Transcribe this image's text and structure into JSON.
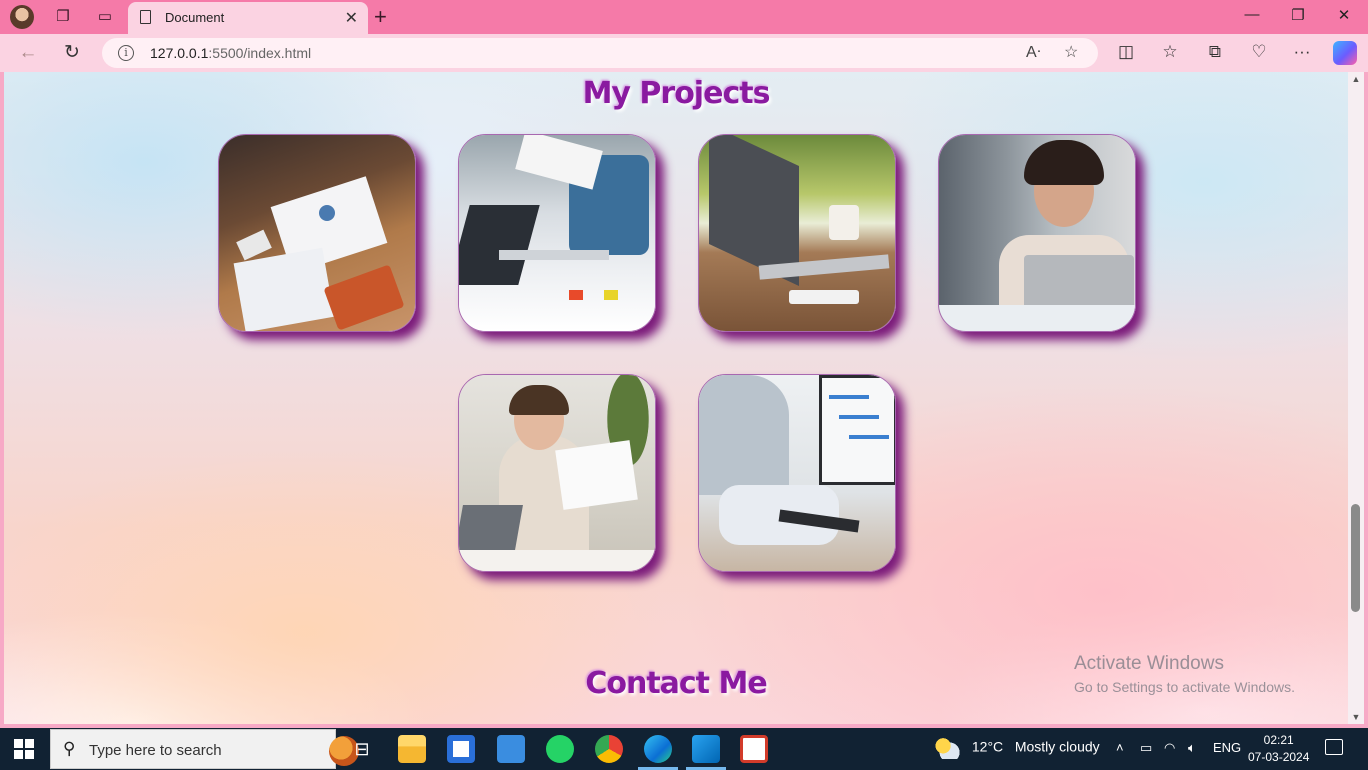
{
  "browser": {
    "tab_title": "Document",
    "url_host": "127.0.0.1",
    "url_rest": ":5500/index.html"
  },
  "page": {
    "projects_heading": "My Projects",
    "contact_heading": "Contact Me",
    "project_images": [
      {
        "icon": "business-meeting-documents-photo"
      },
      {
        "icon": "laptop-teamwork-photo"
      },
      {
        "icon": "laptop-outdoor-desk-photo"
      },
      {
        "icon": "smiling-woman-laptop-photo"
      },
      {
        "icon": "woman-presenting-chart-photo"
      },
      {
        "icon": "gantt-chart-monitor-photo"
      }
    ]
  },
  "watermark": {
    "line1": "Activate Windows",
    "line2": "Go to Settings to activate Windows."
  },
  "taskbar": {
    "search_placeholder": "Type here to search",
    "temperature": "12°C",
    "weather": "Mostly cloudy",
    "language": "ENG",
    "time": "02:21",
    "date": "07-03-2024"
  }
}
